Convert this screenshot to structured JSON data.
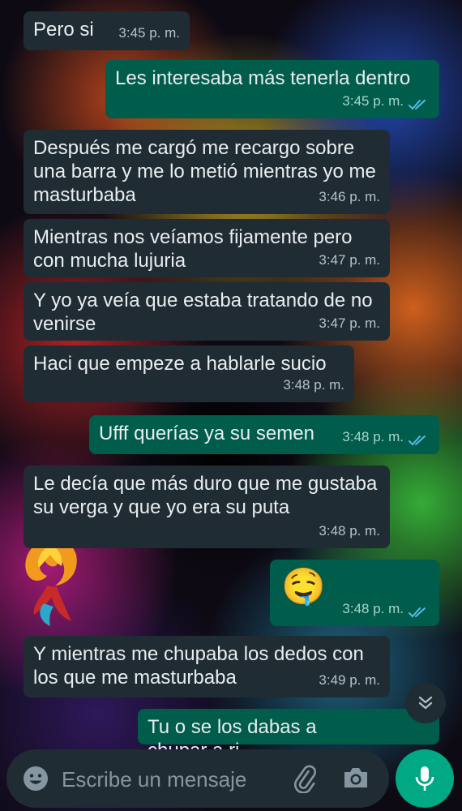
{
  "messages": [
    {
      "direction": "in",
      "text": "Pero si",
      "time": "3:45 p. m."
    },
    {
      "direction": "out",
      "text": "Les interesaba más tenerla dentro",
      "time": "3:45 p. m.",
      "status": "read"
    },
    {
      "direction": "in",
      "text": "Después me cargó me recargo sobre una barra y me lo metió mientras yo me masturbaba",
      "time": "3:46 p. m."
    },
    {
      "direction": "in",
      "text": "Mientras nos veíamos fijamente pero con mucha lujuria",
      "time": "3:47 p. m."
    },
    {
      "direction": "in",
      "text": "Y yo ya veía que estaba tratando de no venirse",
      "time": "3:47 p. m."
    },
    {
      "direction": "in",
      "text": "Haci que empeze a hablarle sucio",
      "time": "3:48 p. m."
    },
    {
      "direction": "out",
      "text": "Ufff querías ya su semen",
      "time": "3:48 p. m.",
      "status": "read"
    },
    {
      "direction": "in",
      "text": "Le decía que más duro que me gustaba su verga y que yo era su puta",
      "time": "3:48 p. m."
    },
    {
      "direction": "out",
      "text": "🤤",
      "time": "3:48 p. m.",
      "status": "read"
    },
    {
      "direction": "in",
      "text": "Y mientras me chupaba los dedos con los que me masturbaba",
      "time": "3:49 p. m."
    },
    {
      "direction": "out",
      "text": "Tu o se los dabas a chupar a ri",
      "time": ""
    }
  ],
  "composer": {
    "placeholder": "Escribe un mensaje",
    "emoji_icon": "emoji-icon",
    "attach_icon": "paperclip-icon",
    "camera_icon": "camera-icon",
    "mic_icon": "microphone-icon"
  },
  "scroll_button": {
    "icon": "double-chevron-down-icon"
  },
  "colors": {
    "incoming_bubble": "#1f2c34",
    "outgoing_bubble": "#005c4b",
    "read_ticks": "#53bdeb",
    "accent": "#00a884"
  }
}
